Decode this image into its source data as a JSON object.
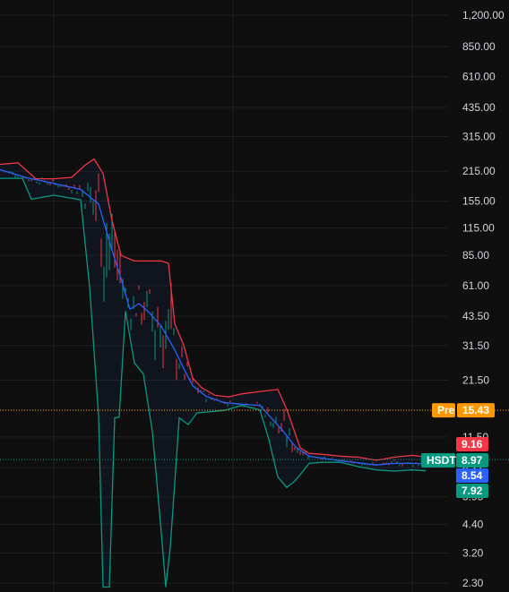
{
  "chart_data": {
    "type": "line",
    "title": "",
    "xlabel": "",
    "ylabel": "",
    "y_scale": "log",
    "ylim": [
      2.1,
      1500
    ],
    "grid": true,
    "y_ticks": [
      "1,200.00",
      "850.00",
      "610.00",
      "435.00",
      "315.00",
      "215.00",
      "155.00",
      "115.00",
      "85.00",
      "61.00",
      "43.50",
      "31.50",
      "21.50",
      "15.50",
      "11.50",
      "8.22",
      "5.95",
      "4.40",
      "3.20",
      "2.30"
    ],
    "y_tick_values": [
      1200,
      850,
      610,
      435,
      315,
      215,
      155,
      115,
      85,
      61,
      43.5,
      31.5,
      21.5,
      15.5,
      11.5,
      8.22,
      5.95,
      4.4,
      3.2,
      2.3
    ],
    "series": [
      {
        "name": "",
        "color": "#f23645",
        "values": [
          [
            0,
            232
          ],
          [
            20,
            236
          ],
          [
            40,
            198
          ],
          [
            60,
            198
          ],
          [
            80,
            201
          ],
          [
            95,
            230
          ],
          [
            105,
            246
          ],
          [
            115,
            210
          ],
          [
            125,
            125
          ],
          [
            135,
            85
          ],
          [
            150,
            80
          ],
          [
            165,
            80
          ],
          [
            180,
            80
          ],
          [
            188,
            78
          ],
          [
            195,
            40
          ],
          [
            205,
            31.6
          ],
          [
            215,
            22
          ],
          [
            225,
            19.8
          ],
          [
            240,
            18.2
          ],
          [
            255,
            17.9
          ],
          [
            270,
            18.5
          ],
          [
            290,
            19.0
          ],
          [
            310,
            19.4
          ],
          [
            320,
            15.6
          ],
          [
            335,
            10.2
          ],
          [
            345,
            9.6
          ],
          [
            360,
            9.5
          ],
          [
            380,
            9.3
          ],
          [
            400,
            9.2
          ],
          [
            420,
            8.9
          ],
          [
            440,
            9.2
          ],
          [
            460,
            9.4
          ],
          [
            480,
            9.16
          ]
        ]
      },
      {
        "name": "",
        "color": "#2962ff",
        "values": [
          [
            0,
            219
          ],
          [
            30,
            200
          ],
          [
            60,
            188
          ],
          [
            90,
            176
          ],
          [
            110,
            150
          ],
          [
            125,
            90
          ],
          [
            135,
            66
          ],
          [
            145,
            47
          ],
          [
            155,
            50
          ],
          [
            165,
            46
          ],
          [
            180,
            39
          ],
          [
            195,
            30
          ],
          [
            205,
            24.5
          ],
          [
            215,
            20.2
          ],
          [
            230,
            18.0
          ],
          [
            250,
            16.8
          ],
          [
            270,
            16.5
          ],
          [
            290,
            16.3
          ],
          [
            300,
            14.6
          ],
          [
            315,
            12.4
          ],
          [
            330,
            10.3
          ],
          [
            345,
            9.3
          ],
          [
            360,
            9.1
          ],
          [
            380,
            8.85
          ],
          [
            400,
            8.65
          ],
          [
            420,
            8.45
          ],
          [
            440,
            8.6
          ],
          [
            460,
            8.6
          ],
          [
            480,
            8.54
          ]
        ]
      },
      {
        "name": "",
        "color": "#089981",
        "values": [
          [
            0,
            199
          ],
          [
            25,
            199
          ],
          [
            35,
            158
          ],
          [
            60,
            165
          ],
          [
            90,
            157
          ],
          [
            100,
            60
          ],
          [
            110,
            14.5
          ],
          [
            115,
            2.2
          ],
          [
            122,
            2.2
          ],
          [
            128,
            14.2
          ],
          [
            133,
            14.3
          ],
          [
            140,
            46
          ],
          [
            150,
            26
          ],
          [
            160,
            23
          ],
          [
            170,
            12.2
          ],
          [
            180,
            4.0
          ],
          [
            185,
            2.2
          ],
          [
            190,
            3.4
          ],
          [
            200,
            14.2
          ],
          [
            210,
            13.2
          ],
          [
            220,
            15.0
          ],
          [
            250,
            15.4
          ],
          [
            270,
            16.3
          ],
          [
            290,
            15.5
          ],
          [
            300,
            11.2
          ],
          [
            310,
            7.4
          ],
          [
            320,
            6.6
          ],
          [
            328,
            7.0
          ],
          [
            335,
            7.6
          ],
          [
            345,
            8.6
          ],
          [
            360,
            8.7
          ],
          [
            380,
            8.7
          ],
          [
            400,
            8.3
          ],
          [
            420,
            8.0
          ],
          [
            440,
            7.9
          ],
          [
            460,
            8.0
          ],
          [
            475,
            7.92
          ]
        ]
      }
    ],
    "price_lines": [
      {
        "label": "Pre",
        "value": "15.43",
        "numeric": 15.43,
        "color": "#ff9800",
        "style": "dotted"
      },
      {
        "label": "HSDT",
        "value": "8.97",
        "numeric": 8.97,
        "color": "#089981",
        "style": "dotted"
      }
    ],
    "value_tags": [
      {
        "value": "9.16",
        "numeric": 9.16,
        "color": "#f23645"
      },
      {
        "value": "8.97",
        "numeric": 8.97,
        "color": "#089981"
      },
      {
        "value": "8.54",
        "numeric": 8.54,
        "color": "#2962ff"
      },
      {
        "value": "7.92",
        "numeric": 7.92,
        "color": "#089981"
      }
    ],
    "candle_colors": {
      "up": "#089981",
      "down": "#f23645"
    }
  }
}
